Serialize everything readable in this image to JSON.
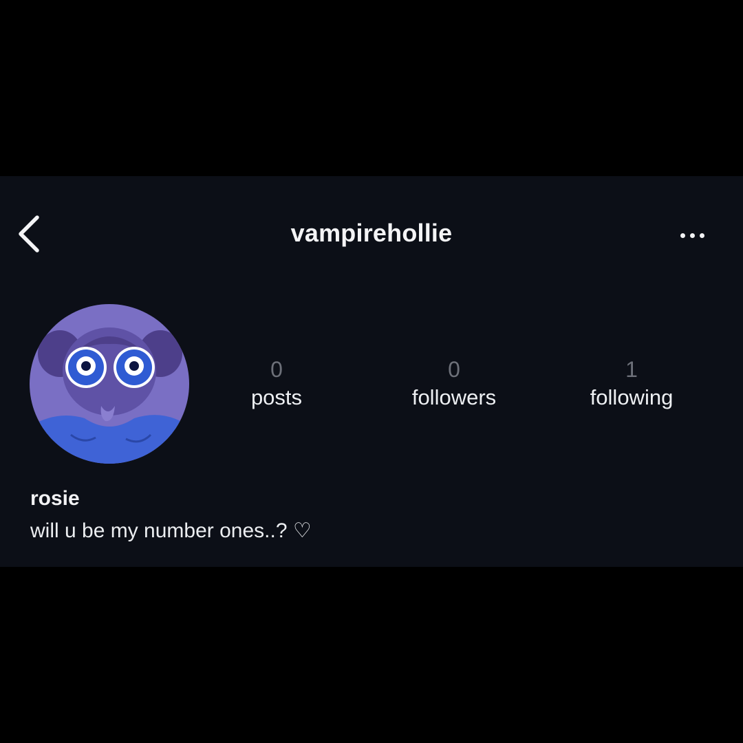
{
  "header": {
    "username": "vampirehollie",
    "back_icon": "chevron-left-icon",
    "more_icon": "more-horizontal-icon"
  },
  "profile": {
    "avatar_icon": "avatar-cartoon-girl",
    "stats": [
      {
        "count": "0",
        "label": "posts"
      },
      {
        "count": "0",
        "label": "followers"
      },
      {
        "count": "1",
        "label": "following"
      }
    ],
    "display_name": "rosie",
    "bio": "will u be my number ones..? ♡"
  },
  "colors": {
    "page_background": "#000000",
    "card_background": "#0c0f17",
    "text_primary": "#f4f4f6",
    "count_text": "#6d7079",
    "avatar_background": "#7a6fc4",
    "avatar_accent": "#3f63d6"
  }
}
